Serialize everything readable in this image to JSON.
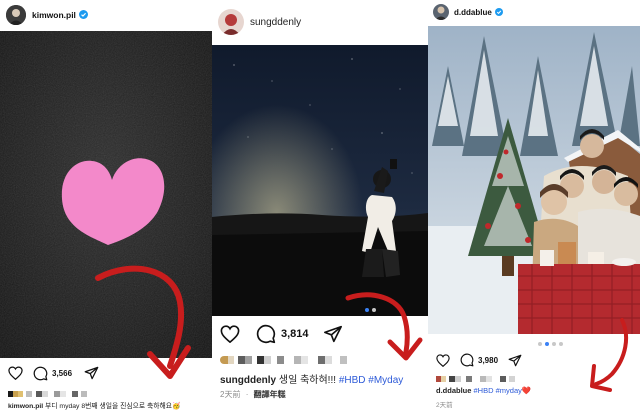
{
  "posts": [
    {
      "username": "kimwon.pil",
      "verified": true,
      "comment_count": "3,566",
      "caption_user": "kimwon.pil",
      "caption_text": "부디 myday 8번째 생일을 진심으로 축하해요",
      "caption_emoji": "🥳"
    },
    {
      "username": "sungddenly",
      "verified": false,
      "comment_count": "3,814",
      "caption_user": "sungddenly",
      "caption_text": "생일 축하혀!!!",
      "caption_tags": [
        "#HBD",
        "#Myday"
      ],
      "time_ago": "2天前",
      "translate_label": "翻譯年糕"
    },
    {
      "username": "d.ddablue",
      "verified": true,
      "comment_count": "3,980",
      "caption_user": "d.ddablue",
      "caption_tags": [
        "#HBD",
        "#myday"
      ],
      "caption_emoji": "❤️",
      "time_ago": "2天前"
    }
  ],
  "colors": {
    "arrow": "#c81d1d",
    "hashtag": "#2e5bd8",
    "verified": "#1d9bf0",
    "carousel_active": "#3b82f6"
  },
  "icons": [
    "heart-icon",
    "comment-icon",
    "share-icon",
    "verified-icon",
    "hand-drawn-arrow"
  ]
}
